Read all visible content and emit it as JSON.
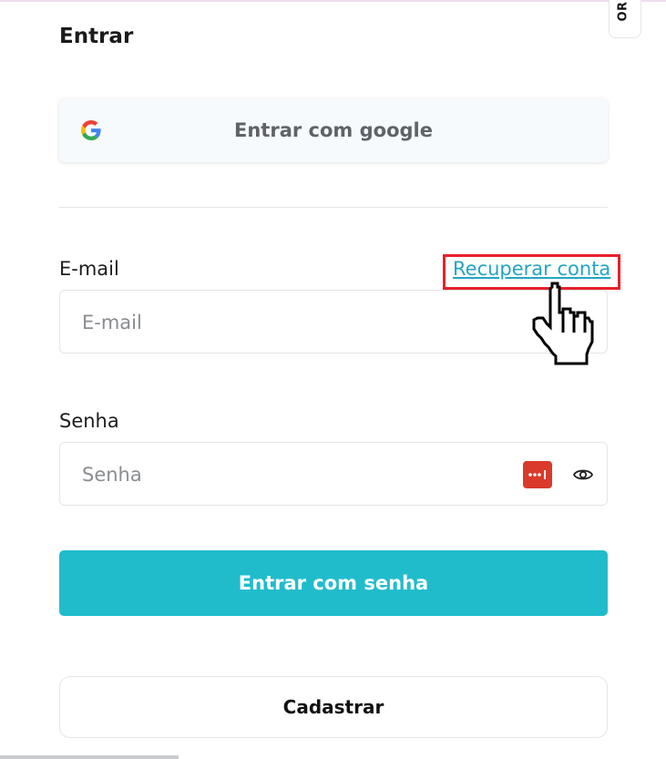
{
  "side_tab": {
    "text": "OR"
  },
  "page": {
    "title": "Entrar"
  },
  "google_button": {
    "label": "Entrar com google"
  },
  "email": {
    "label": "E-mail",
    "placeholder": "E-mail",
    "recover_link": "Recuperar conta"
  },
  "password": {
    "label": "Senha",
    "placeholder": "Senha"
  },
  "buttons": {
    "login": "Entrar com senha",
    "register": "Cadastrar"
  },
  "icons": {
    "google": "google-icon",
    "password_manager": "password-manager-icon",
    "eye": "eye-icon",
    "cursor": "hand-pointer-cursor"
  },
  "colors": {
    "primary": "#21bccc",
    "link": "#23a6c2",
    "highlight": "#e8202a",
    "password_manager": "#d93a2b"
  }
}
